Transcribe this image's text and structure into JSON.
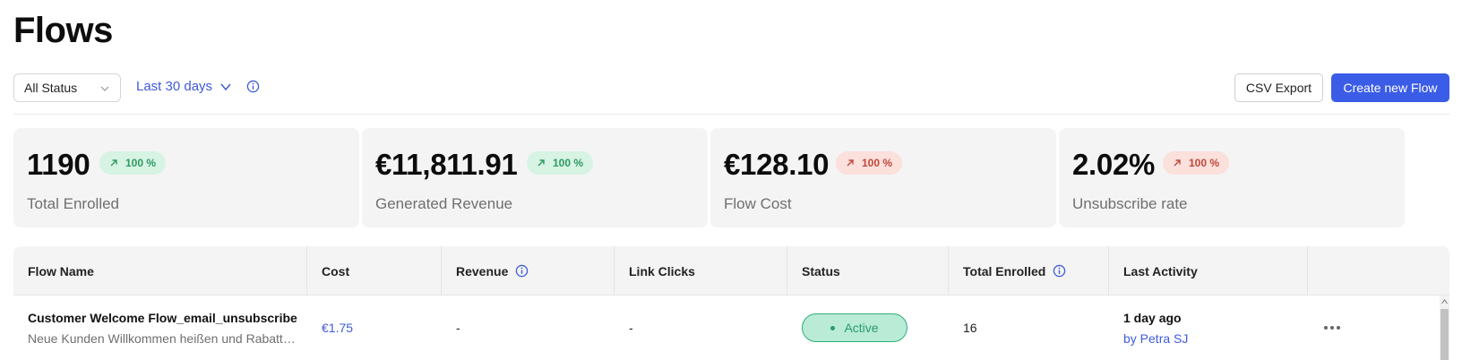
{
  "page": {
    "title": "Flows"
  },
  "filters": {
    "status_select": "All Status",
    "date_range": "Last 30 days"
  },
  "actions": {
    "csv_export": "CSV Export",
    "create_flow": "Create new Flow"
  },
  "stats": [
    {
      "value": "1190",
      "change": "100 %",
      "trend": "up",
      "label": "Total Enrolled"
    },
    {
      "value": "€11,811.91",
      "change": "100 %",
      "trend": "up",
      "label": "Generated Revenue"
    },
    {
      "value": "€128.10",
      "change": "100 %",
      "trend": "down",
      "label": "Flow Cost"
    },
    {
      "value": "2.02%",
      "change": "100 %",
      "trend": "down",
      "label": "Unsubscribe rate"
    }
  ],
  "table": {
    "columns": [
      "Flow Name",
      "Cost",
      "Revenue",
      "Link Clicks",
      "Status",
      "Total Enrolled",
      "Last Activity"
    ],
    "rows": [
      {
        "name": "Customer Welcome Flow_email_unsubscribe",
        "description": "Neue Kunden Willkommen heißen und Rabatt a...",
        "cost": "€1.75",
        "revenue": "-",
        "link_clicks": "-",
        "status": "Active",
        "total_enrolled": "16",
        "last_activity": "1 day ago",
        "last_activity_by": "by Petra SJ"
      }
    ]
  },
  "colors": {
    "accent": "#3b5ce6",
    "link": "#3f5bd9",
    "positive_bg": "#d7f3e3",
    "positive_text": "#2f9a63",
    "negative_bg": "#fbe0dc",
    "negative_text": "#c0473a",
    "active_bg": "#b9ebd7",
    "active_border": "#2fae7a"
  },
  "icons": {
    "select_chevron": "chevron-down-icon",
    "range_chevron": "chevron-down-icon",
    "info": "info-icon",
    "trend_up": "arrow-up-right-icon",
    "more": "more-horizontal-icon"
  }
}
